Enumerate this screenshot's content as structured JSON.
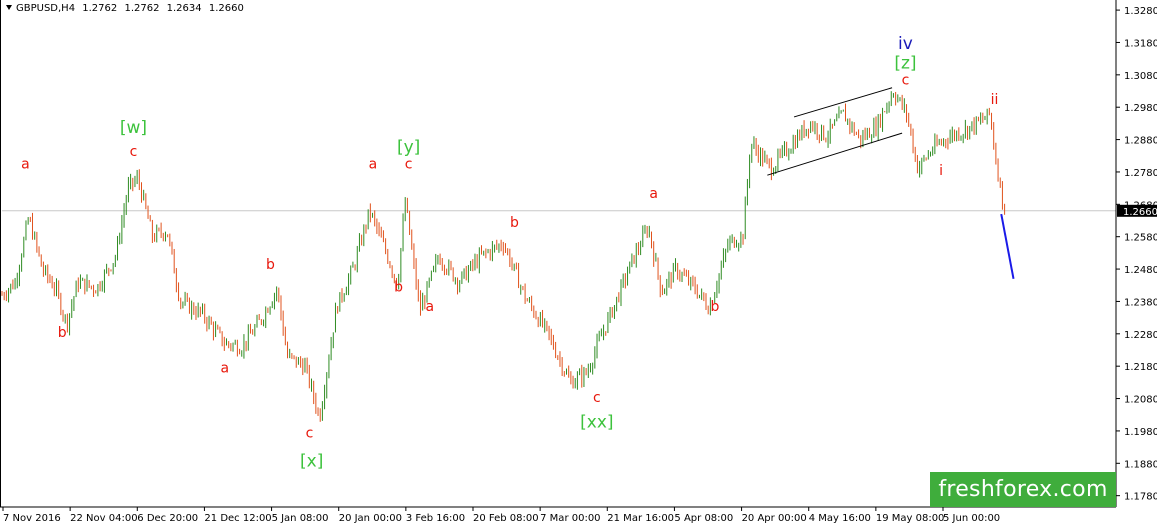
{
  "header": {
    "symbol": "GBPUSD,H4",
    "open": "1.2762",
    "high": "1.2762",
    "low": "1.2634",
    "close": "1.2660"
  },
  "logo_text": "freshforex.com",
  "colors": {
    "background": "#ffffff",
    "axis": "#000000",
    "up_candle": "#2e8b22",
    "down_candle": "#e0521c",
    "wave_red": "#e8180c",
    "wave_green": "#3cc23c",
    "wave_blue": "#1a1ab8",
    "channel": "#000000",
    "forecast": "#1a1ae8",
    "price_line": "#c8c8c8",
    "current_price_bg": "#000000",
    "logo_bg": "#3fad3c"
  },
  "chart_data": {
    "type": "candlestick",
    "timeframe": "H4",
    "ylim": [
      1.1745,
      1.3305
    ],
    "y_ticks": [
      "1.3280",
      "1.3180",
      "1.3080",
      "1.2980",
      "1.2880",
      "1.2780",
      "1.2680",
      "1.2580",
      "1.2480",
      "1.2380",
      "1.2280",
      "1.2180",
      "1.2080",
      "1.1980",
      "1.1880",
      "1.1780"
    ],
    "current_price": "1.2660",
    "x_labels": [
      "7 Nov 2016",
      "22 Nov 04:00",
      "6 Dec 20:00",
      "21 Dec 12:00",
      "5 Jan 08:00",
      "20 Jan 00:00",
      "3 Feb 16:00",
      "20 Feb 08:00",
      "7 Mar 00:00",
      "21 Mar 16:00",
      "5 Apr 08:00",
      "20 Apr 00:00",
      "4 May 16:00",
      "19 May 08:00",
      "5 Jun 00:00"
    ],
    "price_path": [
      {
        "t": 0,
        "p": 1.24
      },
      {
        "t": 0.012,
        "p": 1.244
      },
      {
        "t": 0.024,
        "p": 1.264
      },
      {
        "t": 0.036,
        "p": 1.248
      },
      {
        "t": 0.048,
        "p": 1.242
      },
      {
        "t": 0.058,
        "p": 1.231
      },
      {
        "t": 0.068,
        "p": 1.244
      },
      {
        "t": 0.085,
        "p": 1.242
      },
      {
        "t": 0.102,
        "p": 1.252
      },
      {
        "t": 0.113,
        "p": 1.273
      },
      {
        "t": 0.122,
        "p": 1.276
      },
      {
        "t": 0.135,
        "p": 1.258
      },
      {
        "t": 0.148,
        "p": 1.26
      },
      {
        "t": 0.16,
        "p": 1.238
      },
      {
        "t": 0.18,
        "p": 1.234
      },
      {
        "t": 0.2,
        "p": 1.225
      },
      {
        "t": 0.215,
        "p": 1.224
      },
      {
        "t": 0.232,
        "p": 1.232
      },
      {
        "t": 0.247,
        "p": 1.242
      },
      {
        "t": 0.256,
        "p": 1.221
      },
      {
        "t": 0.272,
        "p": 1.218
      },
      {
        "t": 0.285,
        "p": 1.202
      },
      {
        "t": 0.3,
        "p": 1.236
      },
      {
        "t": 0.315,
        "p": 1.248
      },
      {
        "t": 0.33,
        "p": 1.266
      },
      {
        "t": 0.345,
        "p": 1.253
      },
      {
        "t": 0.355,
        "p": 1.243
      },
      {
        "t": 0.362,
        "p": 1.269
      },
      {
        "t": 0.375,
        "p": 1.235
      },
      {
        "t": 0.392,
        "p": 1.252
      },
      {
        "t": 0.41,
        "p": 1.244
      },
      {
        "t": 0.43,
        "p": 1.252
      },
      {
        "t": 0.45,
        "p": 1.256
      },
      {
        "t": 0.47,
        "p": 1.239
      },
      {
        "t": 0.49,
        "p": 1.228
      },
      {
        "t": 0.51,
        "p": 1.213
      },
      {
        "t": 0.525,
        "p": 1.216
      },
      {
        "t": 0.535,
        "p": 1.225
      },
      {
        "t": 0.55,
        "p": 1.237
      },
      {
        "t": 0.565,
        "p": 1.25
      },
      {
        "t": 0.58,
        "p": 1.261
      },
      {
        "t": 0.592,
        "p": 1.241
      },
      {
        "t": 0.605,
        "p": 1.248
      },
      {
        "t": 0.622,
        "p": 1.242
      },
      {
        "t": 0.635,
        "p": 1.236
      },
      {
        "t": 0.652,
        "p": 1.256
      },
      {
        "t": 0.665,
        "p": 1.258
      },
      {
        "t": 0.672,
        "p": 1.287
      },
      {
        "t": 0.69,
        "p": 1.279
      },
      {
        "t": 0.71,
        "p": 1.287
      },
      {
        "t": 0.725,
        "p": 1.293
      },
      {
        "t": 0.74,
        "p": 1.289
      },
      {
        "t": 0.755,
        "p": 1.296
      },
      {
        "t": 0.77,
        "p": 1.288
      },
      {
        "t": 0.785,
        "p": 1.292
      },
      {
        "t": 0.8,
        "p": 1.303
      },
      {
        "t": 0.812,
        "p": 1.296
      },
      {
        "t": 0.822,
        "p": 1.279
      },
      {
        "t": 0.835,
        "p": 1.285
      },
      {
        "t": 0.85,
        "p": 1.289
      },
      {
        "t": 0.865,
        "p": 1.291
      },
      {
        "t": 0.88,
        "p": 1.294
      },
      {
        "t": 0.887,
        "p": 1.296
      },
      {
        "t": 0.892,
        "p": 1.282
      },
      {
        "t": 0.9,
        "p": 1.266
      }
    ],
    "channel_lines": [
      {
        "t1": 0.711,
        "p1": 1.295,
        "t2": 0.799,
        "p2": 1.304
      },
      {
        "t1": 0.687,
        "p1": 1.277,
        "t2": 0.808,
        "p2": 1.29
      }
    ],
    "forecast_line": {
      "t1": 0.897,
      "p1": 1.265,
      "t2": 0.908,
      "p2": 1.245
    },
    "wave_labels": [
      {
        "text": "a",
        "t": 0.021,
        "p": 1.279,
        "color": "red"
      },
      {
        "text": "b",
        "t": 0.054,
        "p": 1.227,
        "color": "red"
      },
      {
        "text": "[w]",
        "t": 0.118,
        "p": 1.29,
        "color": "green"
      },
      {
        "text": "c",
        "t": 0.118,
        "p": 1.283,
        "color": "red"
      },
      {
        "text": "a",
        "t": 0.2,
        "p": 1.216,
        "color": "red"
      },
      {
        "text": "b",
        "t": 0.241,
        "p": 1.248,
        "color": "red"
      },
      {
        "text": "c",
        "t": 0.276,
        "p": 1.196,
        "color": "red"
      },
      {
        "text": "[x]",
        "t": 0.278,
        "p": 1.187,
        "color": "green"
      },
      {
        "text": "a",
        "t": 0.333,
        "p": 1.279,
        "color": "red"
      },
      {
        "text": "[y]",
        "t": 0.365,
        "p": 1.284,
        "color": "green"
      },
      {
        "text": "c",
        "t": 0.365,
        "p": 1.279,
        "color": "red"
      },
      {
        "text": "b",
        "t": 0.356,
        "p": 1.241,
        "color": "red"
      },
      {
        "text": "a",
        "t": 0.384,
        "p": 1.235,
        "color": "red"
      },
      {
        "text": "b",
        "t": 0.46,
        "p": 1.261,
        "color": "red"
      },
      {
        "text": "c",
        "t": 0.534,
        "p": 1.207,
        "color": "red"
      },
      {
        "text": "[xx]",
        "t": 0.534,
        "p": 1.199,
        "color": "green"
      },
      {
        "text": "a",
        "t": 0.585,
        "p": 1.27,
        "color": "red"
      },
      {
        "text": "b",
        "t": 0.64,
        "p": 1.235,
        "color": "red"
      },
      {
        "text": "iv",
        "t": 0.811,
        "p": 1.316,
        "color": "blue"
      },
      {
        "text": "[z]",
        "t": 0.811,
        "p": 1.31,
        "color": "green"
      },
      {
        "text": "c",
        "t": 0.811,
        "p": 1.305,
        "color": "red"
      },
      {
        "text": "ii",
        "t": 0.891,
        "p": 1.299,
        "color": "red"
      },
      {
        "text": "i",
        "t": 0.843,
        "p": 1.277,
        "color": "red"
      }
    ]
  }
}
